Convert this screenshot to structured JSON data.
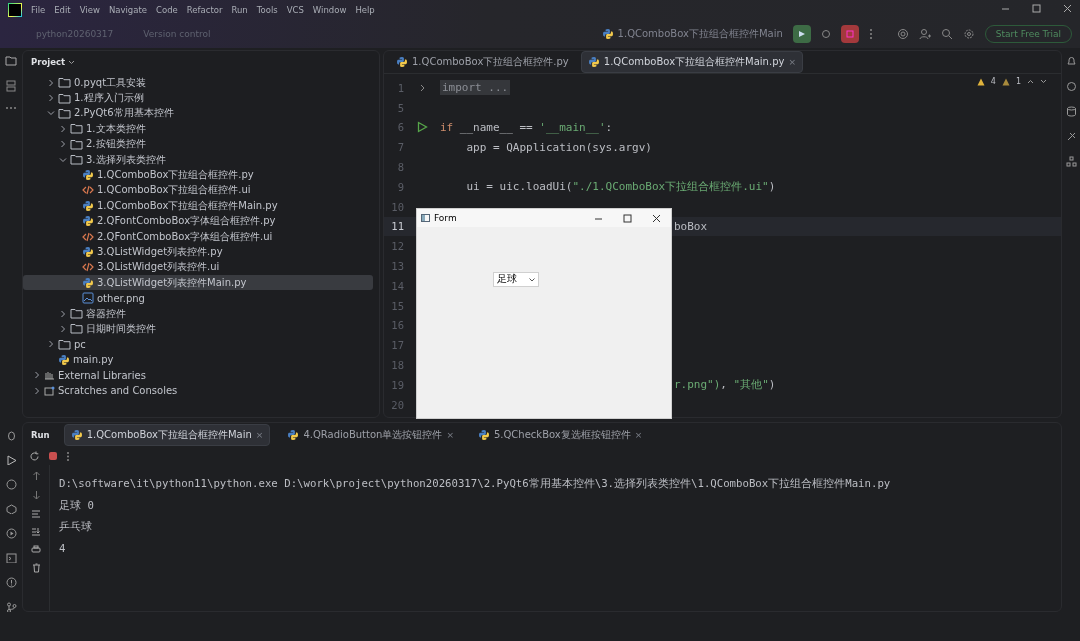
{
  "menu": [
    "File",
    "Edit",
    "View",
    "Navigate",
    "Code",
    "Refactor",
    "Run",
    "Tools",
    "VCS",
    "Window",
    "Help"
  ],
  "toolbar": {
    "project": "python20260317",
    "vcs": "Version control",
    "run_config": "1.QComboBox下拉组合框控件Main",
    "trial": "Start Free Trial"
  },
  "project_panel": {
    "title": "Project",
    "tree": [
      {
        "label": "0.pyqt工具安装",
        "kind": "folder",
        "expanded": false,
        "selected": false
      },
      {
        "label": "1.程序入门示例",
        "kind": "folder",
        "expanded": false,
        "selected": false
      },
      {
        "label": "2.PyQt6常用基本控件",
        "kind": "folder",
        "expanded": true,
        "selected": false,
        "children": [
          {
            "label": "1.文本类控件",
            "kind": "folder",
            "expanded": false,
            "selected": false
          },
          {
            "label": "2.按钮类控件",
            "kind": "folder",
            "expanded": false,
            "selected": false
          },
          {
            "label": "3.选择列表类控件",
            "kind": "folder",
            "expanded": true,
            "selected": false,
            "children": [
              {
                "label": "1.QComboBox下拉组合框控件.py",
                "kind": "python",
                "selected": false
              },
              {
                "label": "1.QComboBox下拉组合框控件.ui",
                "kind": "ui",
                "selected": false
              },
              {
                "label": "1.QComboBox下拉组合框控件Main.py",
                "kind": "python",
                "selected": false
              },
              {
                "label": "2.QFontComboBox字体组合框控件.py",
                "kind": "python",
                "selected": false
              },
              {
                "label": "2.QFontComboBox字体组合框控件.ui",
                "kind": "ui",
                "selected": false
              },
              {
                "label": "3.QListWidget列表控件.py",
                "kind": "python",
                "selected": false
              },
              {
                "label": "3.QListWidget列表控件.ui",
                "kind": "ui",
                "selected": false
              },
              {
                "label": "3.QListWidget列表控件Main.py",
                "kind": "python",
                "selected": true
              },
              {
                "label": "other.png",
                "kind": "image",
                "selected": false
              }
            ]
          },
          {
            "label": "容器控件",
            "kind": "folder",
            "expanded": false,
            "selected": false
          },
          {
            "label": "日期时间类控件",
            "kind": "folder",
            "expanded": false,
            "selected": false
          }
        ]
      },
      {
        "label": "pc",
        "kind": "folder",
        "expanded": false,
        "selected": false
      },
      {
        "label": "main.py",
        "kind": "python",
        "selected": false
      }
    ],
    "extra": [
      {
        "label": "External Libraries",
        "kind": "library"
      },
      {
        "label": "Scratches and Consoles",
        "kind": "scratches"
      }
    ]
  },
  "editor": {
    "tabs": [
      {
        "label": "1.QComboBox下拉组合框控件.py",
        "selected": false
      },
      {
        "label": "1.QComboBox下拉组合框控件Main.py",
        "selected": true,
        "close": "×"
      }
    ],
    "warnings": "4",
    "weak_warnings": "1",
    "lines": [
      {
        "number": "1",
        "kind": "folded",
        "text": "import ...",
        "current": false
      },
      {
        "number": "5",
        "kind": "code",
        "current": false
      },
      {
        "number": "6",
        "kind": "code",
        "run": true,
        "tokens": [
          {
            "t": "if",
            "kind": "keyword"
          },
          {
            "t": " __name__ == ",
            "kind": "plain"
          },
          {
            "t": "'__main__'",
            "kind": "string"
          },
          {
            "t": ":",
            "kind": "plain"
          }
        ],
        "current": false
      },
      {
        "number": "7",
        "kind": "code",
        "tokens": [
          {
            "t": "    app = QApplication(sys.argv)",
            "kind": "plain"
          }
        ],
        "current": false
      },
      {
        "number": "8",
        "kind": "code",
        "current": false
      },
      {
        "number": "9",
        "kind": "code",
        "tokens": [
          {
            "t": "    ui = uic.loadUi(",
            "kind": "plain"
          },
          {
            "t": "\"./1.QComboBox下拉组合框控件.ui\"",
            "kind": "string"
          },
          {
            "t": ")",
            "kind": "plain"
          }
        ],
        "current": false
      },
      {
        "number": "10",
        "kind": "code",
        "current": false
      },
      {
        "number": "11",
        "kind": "partial",
        "tokens": [
          {
            "t": "boBox",
            "kind": "plain"
          }
        ],
        "current": true
      },
      {
        "number": "12",
        "kind": "code",
        "current": false
      },
      {
        "number": "13",
        "kind": "code",
        "current": false
      },
      {
        "number": "14",
        "kind": "code",
        "current": false
      },
      {
        "number": "15",
        "kind": "code",
        "current": false
      },
      {
        "number": "16",
        "kind": "code",
        "current": false
      },
      {
        "number": "17",
        "kind": "code",
        "current": false
      },
      {
        "number": "18",
        "kind": "code",
        "current": false
      },
      {
        "number": "19",
        "kind": "partial",
        "tokens": [
          {
            "t": "r.png\")",
            "kind": "string"
          },
          {
            "t": ", ",
            "kind": "plain"
          },
          {
            "t": "\"其他\"",
            "kind": "string"
          },
          {
            "t": ")",
            "kind": "plain"
          }
        ],
        "current": false
      },
      {
        "number": "20",
        "kind": "code",
        "current": false
      }
    ]
  },
  "form_window": {
    "title": "Form",
    "combo": "足球"
  },
  "run_panel": {
    "title": "Run",
    "tabs": [
      {
        "label": "1.QComboBox下拉组合框控件Main",
        "selected": true,
        "close": "×"
      },
      {
        "label": "4.QRadioButton单选按钮控件",
        "selected": false,
        "close": "×"
      },
      {
        "label": "5.QCheckBox复选框按钮控件",
        "selected": false,
        "close": "×"
      }
    ],
    "output": [
      "D:\\software\\it\\python11\\python.exe D:\\work\\project\\python20260317\\2.PyQt6常用基本控件\\3.选择列表类控件\\1.QComboBox下拉组合框控件Main.py",
      "足球 0",
      "乒乓球",
      "4"
    ]
  }
}
